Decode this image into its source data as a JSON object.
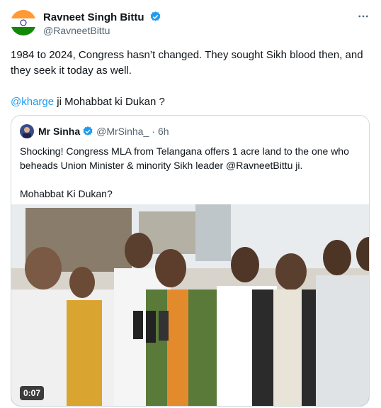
{
  "tweet": {
    "author_name": "Ravneet Singh Bittu",
    "handle": "@RavneetBittu",
    "more_icon": "more-horizontal-icon",
    "text_line1": "1984 to 2024, Congress hasn’t changed. They sought Sikh blood then, and they seek it today as well.",
    "mention": "@kharge",
    "text_line2_rest": " ji Mohabbat ki Dukan ?"
  },
  "quoted": {
    "author_name": "Mr Sinha",
    "handle": "@MrSinha_",
    "separator": "·",
    "time": "6h",
    "text_line1": "Shocking! Congress MLA from Telangana offers 1 acre land to the one who beheads Union Minister & minority Sikh leader @RavneetBittu ji.",
    "text_line2": "Mohabbat Ki Dukan?",
    "video_duration": "0:07"
  },
  "colors": {
    "link": "#1d9bf0",
    "verified": "#1d9bf0",
    "secondary_text": "#536471",
    "border": "#cfd9de"
  }
}
